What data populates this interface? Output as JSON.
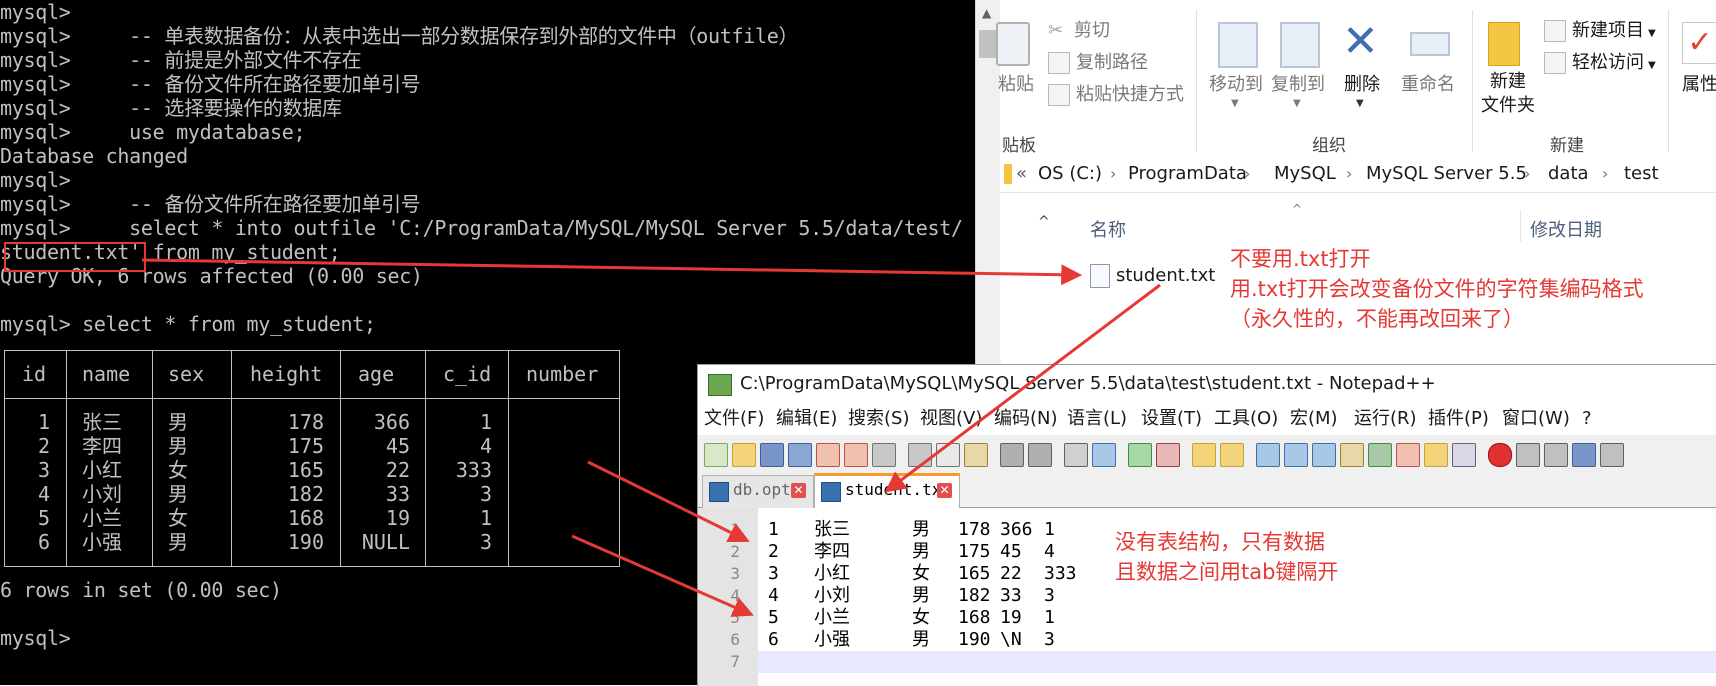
{
  "terminal": {
    "lines": [
      "mysql>",
      "mysql>     -- 单表数据备份：从表中选出一部分数据保存到外部的文件中（outfile）",
      "mysql>     -- 前提是外部文件不存在",
      "mysql>     -- 备份文件所在路径要加单引号",
      "mysql>     -- 选择要操作的数据库",
      "mysql>     use mydatabase;",
      "Database changed",
      "mysql>",
      "mysql>     -- 备份文件所在路径要加单引号",
      "mysql>     select * into outfile 'C:/ProgramData/MySQL/MySQL Server 5.5/data/test/",
      "student.txt' from my_student;",
      "Query OK, 6 rows affected (0.00 sec)",
      "",
      "mysql> select * from my_student;"
    ],
    "table_headers": [
      "id",
      "name",
      "sex",
      "height",
      "age",
      "c_id",
      "number"
    ],
    "table_rows": [
      [
        "1",
        "张三",
        "男",
        "178",
        "366",
        "1",
        ""
      ],
      [
        "2",
        "李四",
        "男",
        "175",
        "45",
        "4",
        ""
      ],
      [
        "3",
        "小红",
        "女",
        "165",
        "22",
        "333",
        ""
      ],
      [
        "4",
        "小刘",
        "男",
        "182",
        "33",
        "3",
        ""
      ],
      [
        "5",
        "小兰",
        "女",
        "168",
        "19",
        "1",
        ""
      ],
      [
        "6",
        "小强",
        "男",
        "190",
        "NULL",
        "3",
        ""
      ]
    ],
    "footer_lines": [
      "6 rows in set (0.00 sec)",
      "",
      "mysql>"
    ],
    "highlight_text": "student.txt'"
  },
  "explorer": {
    "ribbon": {
      "paste_label": "粘贴",
      "cut_label": "剪切",
      "copy_path_label": "复制路径",
      "paste_shortcut_label": "粘贴快捷方式",
      "move_to_label": "移动到",
      "copy_to_label": "复制到",
      "delete_label": "删除",
      "rename_label": "重命名",
      "new_folder_label": "新建\n文件夹",
      "new_item_label": "新建项目",
      "easy_access_label": "轻松访问",
      "properties_label": "属性",
      "group_clipboard": "贴板",
      "group_organize": "组织",
      "group_new": "新建"
    },
    "address": {
      "prefix": "«",
      "crumbs": [
        "OS (C:)",
        "ProgramData",
        "MySQL",
        "MySQL Server 5.5",
        "data",
        "test"
      ]
    },
    "columns": {
      "name": "名称",
      "date_modified": "修改日期"
    },
    "files": [
      {
        "name": "student.txt"
      }
    ]
  },
  "annotations": {
    "top": [
      "不要用.txt打开",
      "用.txt打开会改变备份文件的字符集编码格式",
      "（永久性的，不能再改回来了）"
    ],
    "bottom": [
      "没有表结构，只有数据",
      "且数据之间用tab键隔开"
    ],
    "color": "#e53935"
  },
  "notepad": {
    "title": "C:\\ProgramData\\MySQL\\MySQL Server 5.5\\data\\test\\student.txt - Notepad++",
    "menu": [
      "文件(F)",
      "编辑(E)",
      "搜索(S)",
      "视图(V)",
      "编码(N)",
      "语言(L)",
      "设置(T)",
      "工具(O)",
      "宏(M)",
      "运行(R)",
      "插件(P)",
      "窗口(W)",
      "?"
    ],
    "tabs": [
      {
        "label": "db.opt"
      },
      {
        "label": "student.txt"
      }
    ],
    "line_numbers": [
      "1",
      "2",
      "3",
      "4",
      "5",
      "6",
      "7"
    ],
    "rows": [
      [
        "1",
        "张三",
        "男",
        "178",
        "366",
        "1"
      ],
      [
        "2",
        "李四",
        "男",
        "175",
        "45",
        "4"
      ],
      [
        "3",
        "小红",
        "女",
        "165",
        "22",
        "333"
      ],
      [
        "4",
        "小刘",
        "男",
        "182",
        "33",
        "3"
      ],
      [
        "5",
        "小兰",
        "女",
        "168",
        "19",
        "1"
      ],
      [
        "6",
        "小强",
        "男",
        "190",
        "\\N",
        "3"
      ]
    ],
    "tab_accent_color": "#fa9a28"
  }
}
